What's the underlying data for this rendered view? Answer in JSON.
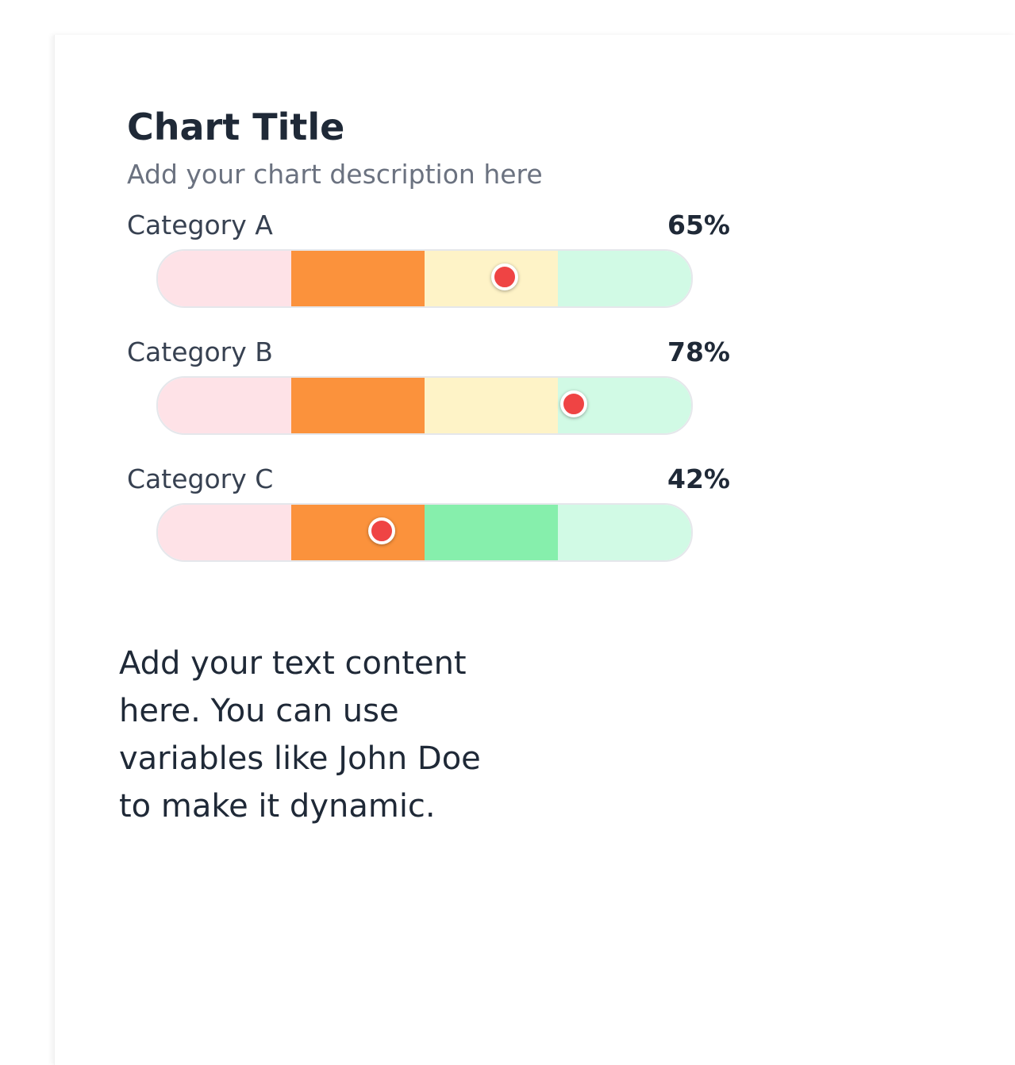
{
  "chart_data": {
    "type": "bar",
    "title": "Chart Title",
    "subtitle": "Add your chart description here",
    "categories": [
      "Category A",
      "Category B",
      "Category C"
    ],
    "values": [
      65,
      78,
      42
    ],
    "value_labels": [
      "65%",
      "78%",
      "42%"
    ],
    "range": [
      0,
      100
    ],
    "bands": [
      {
        "colors": [
          "#fee2e7",
          "#fb923c",
          "#fef3c7",
          "#d1fae5"
        ]
      },
      {
        "colors": [
          "#fee2e7",
          "#fb923c",
          "#fef3c7",
          "#d1fae5"
        ]
      },
      {
        "colors": [
          "#fee2e7",
          "#fb923c",
          "#86efac",
          "#d1fae5"
        ]
      }
    ],
    "marker_color": "#ef4444"
  },
  "body": {
    "text": "Add your text content here. You can use variables like John Doe to make it dynamic."
  }
}
